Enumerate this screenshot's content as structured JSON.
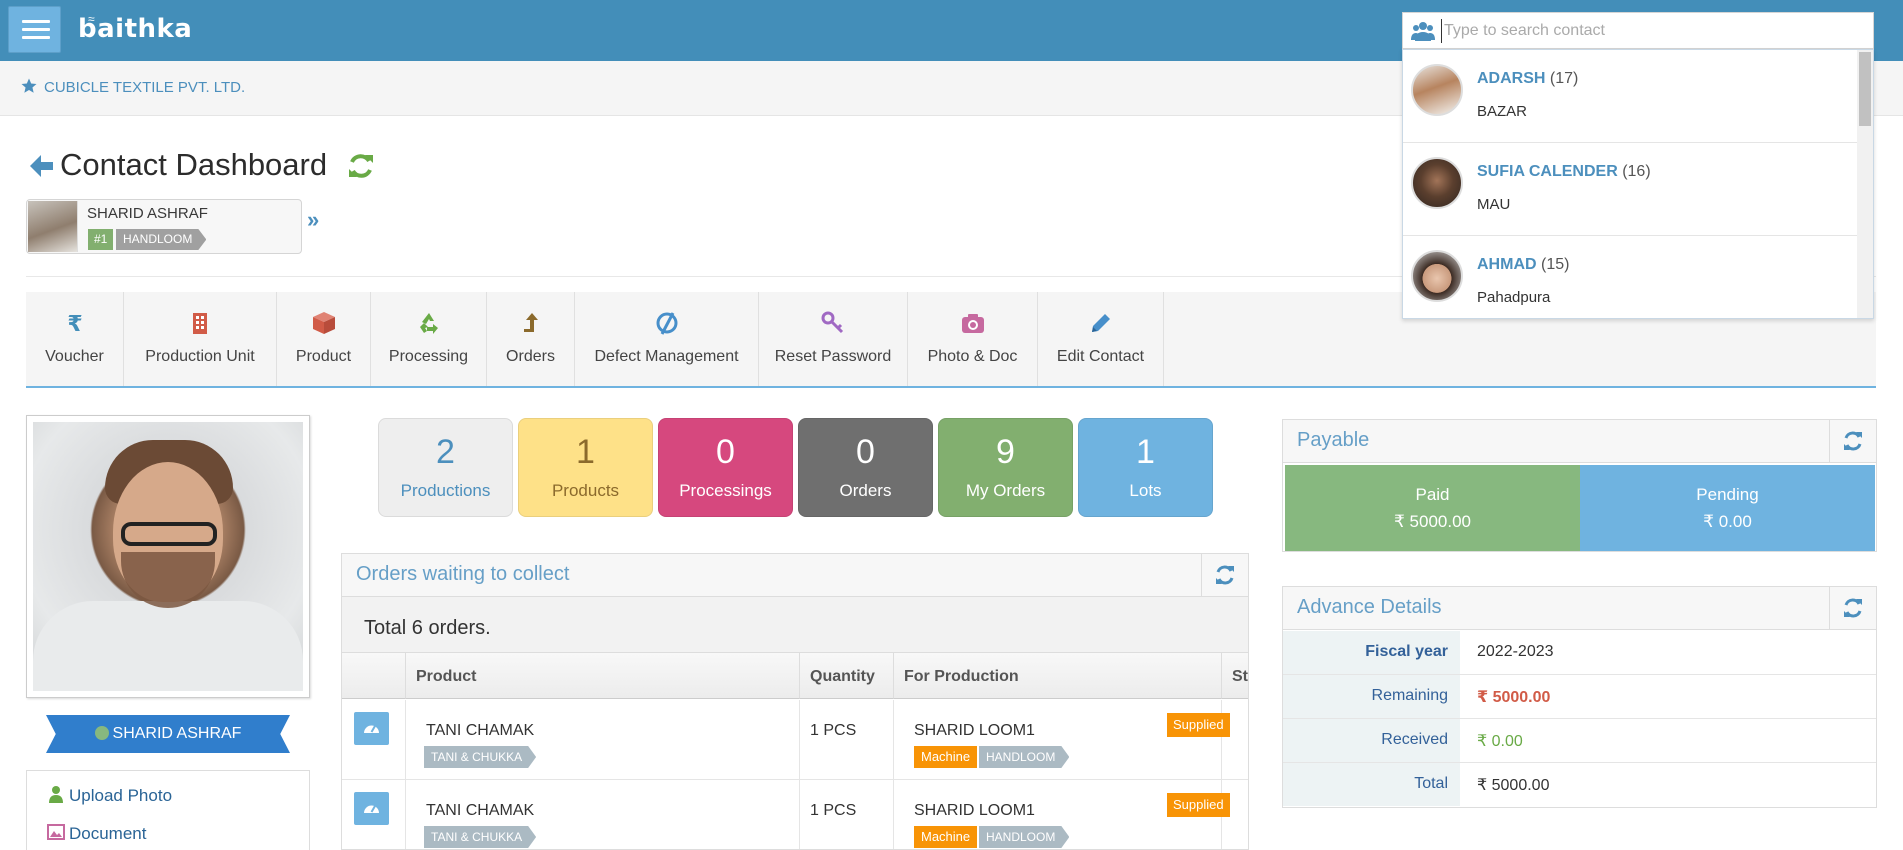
{
  "app": {
    "logo": "baithka"
  },
  "search": {
    "placeholder": "Type to search contact"
  },
  "breadcrumb": {
    "company": "CUBICLE TEXTILE PVT. LTD."
  },
  "page": {
    "title": "Contact Dashboard"
  },
  "contact": {
    "name": "SHARID ASHRAF",
    "rank": "#1",
    "type": "HANDLOOM"
  },
  "toolbar": [
    {
      "label": "Voucher",
      "icon": "rupee-icon",
      "color": "#438eb9"
    },
    {
      "label": "Production Unit",
      "icon": "building-icon",
      "color": "#d15b47"
    },
    {
      "label": "Product",
      "icon": "cube-icon",
      "color": "#d15b47"
    },
    {
      "label": "Processing",
      "icon": "recycle-icon",
      "color": "#69aa46"
    },
    {
      "label": "Orders",
      "icon": "level-up-icon",
      "color": "#8b6a2c"
    },
    {
      "label": "Defect Management",
      "icon": "ban-icon",
      "color": "#478fca"
    },
    {
      "label": "Reset Password",
      "icon": "key-icon",
      "color": "#a069c3"
    },
    {
      "label": "Photo & Doc",
      "icon": "camera-icon",
      "color": "#c6699f"
    },
    {
      "label": "Edit Contact",
      "icon": "pencil-icon",
      "color": "#478fca"
    }
  ],
  "profile": {
    "name": "SHARID ASHRAF",
    "links": [
      {
        "label": "Upload Photo",
        "icon": "user-icon"
      },
      {
        "label": "Document",
        "icon": "picture-icon"
      }
    ]
  },
  "stats": [
    {
      "value": "2",
      "label": "Productions",
      "bg": "#eeeeee",
      "fg": "#4c8fbd"
    },
    {
      "value": "1",
      "label": "Products",
      "bg": "#fee188",
      "fg": "#8b6a2c"
    },
    {
      "value": "0",
      "label": "Processings",
      "bg": "#d6487e",
      "fg": "#ffffff"
    },
    {
      "value": "0",
      "label": "Orders",
      "bg": "#6f6f6f",
      "fg": "#ffffff"
    },
    {
      "value": "9",
      "label": "My Orders",
      "bg": "#82af6f",
      "fg": "#ffffff"
    },
    {
      "value": "1",
      "label": "Lots",
      "bg": "#6fb3e0",
      "fg": "#ffffff"
    }
  ],
  "orders": {
    "title": "Orders waiting to collect",
    "total": "Total 6 orders.",
    "columns": [
      "Product",
      "Quantity",
      "For Production",
      "Status"
    ],
    "rows": [
      {
        "product": "TANI CHAMAK",
        "product_tag": "TANI & CHUKKA",
        "quantity": "1 PCS",
        "production": "SHARID LOOM1",
        "prod_tag1": "Machine",
        "prod_tag2": "HANDLOOM",
        "status": "Supplied"
      },
      {
        "product": "TANI CHAMAK",
        "product_tag": "TANI & CHUKKA",
        "quantity": "1 PCS",
        "production": "SHARID LOOM1",
        "prod_tag1": "Machine",
        "prod_tag2": "HANDLOOM",
        "status": "Supplied"
      }
    ]
  },
  "payable": {
    "title": "Payable",
    "paid_label": "Paid",
    "paid_value": "₹ 5000.00",
    "pending_label": "Pending",
    "pending_value": "₹ 0.00"
  },
  "advance": {
    "title": "Advance Details",
    "rows": [
      {
        "key": "Fiscal year",
        "value": "2022-2023",
        "color": "#333333"
      },
      {
        "key": "Remaining",
        "value": "₹ 5000.00",
        "color": "#d15b47"
      },
      {
        "key": "Received",
        "value": "₹ 0.00",
        "color": "#69aa46"
      },
      {
        "key": "Total",
        "value": "₹ 5000.00",
        "color": "#333333"
      }
    ]
  },
  "dropdown": [
    {
      "name": "ADARSH",
      "count": "(17)",
      "place": "BAZAR"
    },
    {
      "name": "SUFIA CALENDER",
      "count": "(16)",
      "place": "MAU"
    },
    {
      "name": "AHMAD",
      "count": "(15)",
      "place": "Pahadpura"
    }
  ]
}
